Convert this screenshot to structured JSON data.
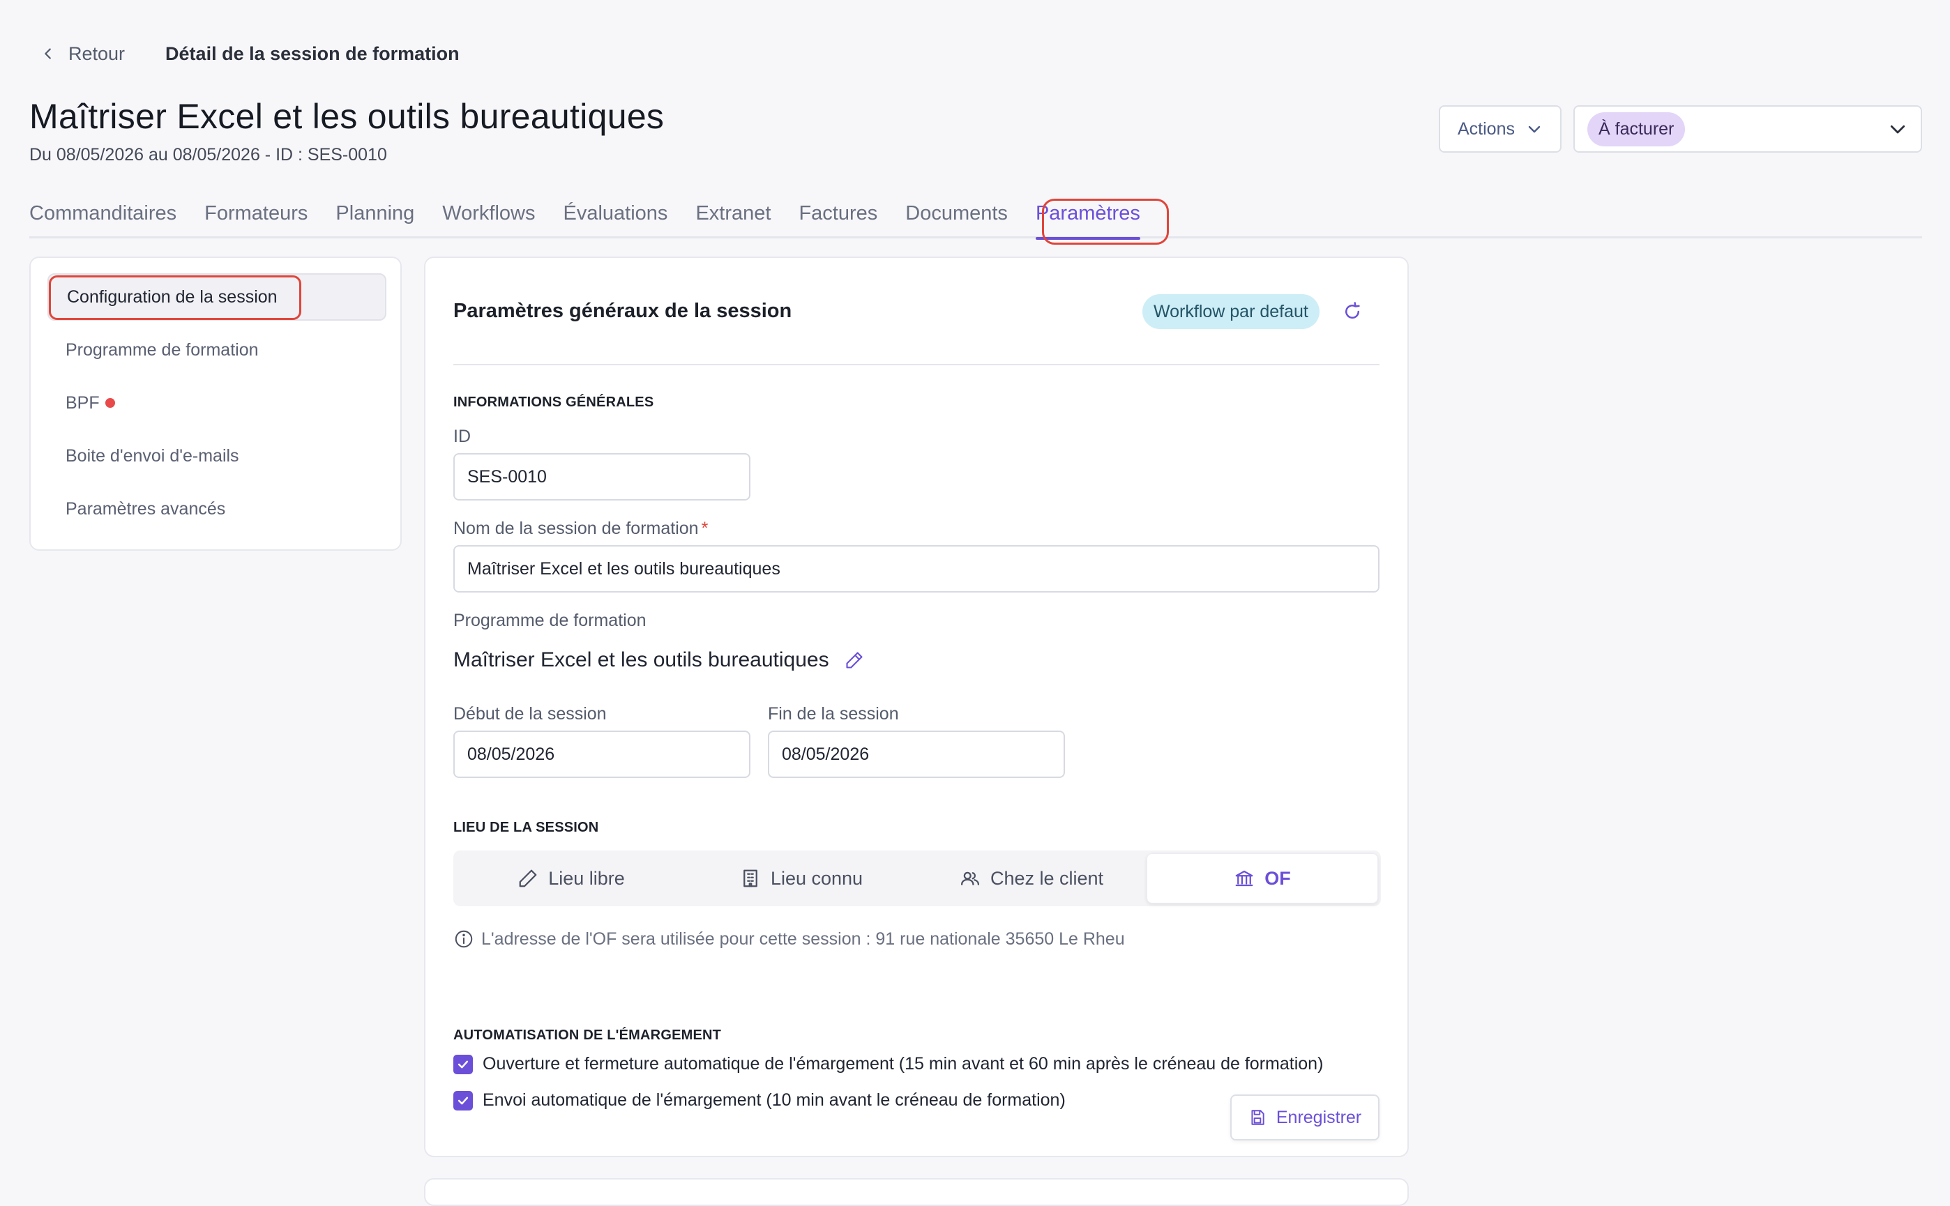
{
  "header": {
    "back_label": "Retour",
    "breadcrumb_title": "Détail de la session de formation",
    "title": "Maîtriser Excel et les outils bureautiques",
    "subtitle": "Du 08/05/2026 au 08/05/2026 - ID : SES-0010",
    "actions_label": "Actions",
    "status_value": "À facturer",
    "status_color": "#e3d5f8"
  },
  "tabs": [
    {
      "label": "Commanditaires",
      "active": false
    },
    {
      "label": "Formateurs",
      "active": false
    },
    {
      "label": "Planning",
      "active": false
    },
    {
      "label": "Workflows",
      "active": false
    },
    {
      "label": "Évaluations",
      "active": false
    },
    {
      "label": "Extranet",
      "active": false
    },
    {
      "label": "Factures",
      "active": false
    },
    {
      "label": "Documents",
      "active": false
    },
    {
      "label": "Paramètres",
      "active": true
    }
  ],
  "sidebar": {
    "items": [
      {
        "label": "Configuration de la session",
        "active": true
      },
      {
        "label": "Programme de formation",
        "active": false
      },
      {
        "label": "BPF",
        "active": false,
        "alert": true
      },
      {
        "label": "Boite d'envoi d'e-mails",
        "active": false
      },
      {
        "label": "Paramètres avancés",
        "active": false
      }
    ]
  },
  "card": {
    "title": "Paramètres généraux de la session",
    "workflow_badge": "Workflow par defaut",
    "sections": {
      "general": "INFORMATIONS GÉNÉRALES",
      "lieu": "LIEU DE LA SESSION",
      "emargement": "AUTOMATISATION DE L'ÉMARGEMENT"
    },
    "fields": {
      "id_label": "ID",
      "id_value": "SES-0010",
      "name_label": "Nom de la session de formation",
      "name_required": "*",
      "name_value": "Maîtriser Excel et les outils bureautiques",
      "programme_label": "Programme de formation",
      "programme_value": "Maîtriser Excel et les outils bureautiques",
      "start_label": "Début de la session",
      "start_value": "08/05/2026",
      "end_label": "Fin de la session",
      "end_value": "08/05/2026"
    },
    "lieu_options": [
      {
        "label": "Lieu libre",
        "icon": "pencil-icon",
        "active": false
      },
      {
        "label": "Lieu connu",
        "icon": "building-icon",
        "active": false
      },
      {
        "label": "Chez le client",
        "icon": "users-icon",
        "active": false
      },
      {
        "label": "OF",
        "icon": "bank-icon",
        "active": true
      }
    ],
    "lieu_info": "L'adresse de l'OF sera utilisée pour cette session : 91 rue nationale 35650 Le Rheu",
    "checks": [
      {
        "label": "Ouverture et fermeture automatique de l'émargement (15 min avant et 60 min après le créneau de formation)",
        "checked": true
      },
      {
        "label": "Envoi automatique de l'émargement (10 min avant le créneau de formation)",
        "checked": true
      }
    ],
    "save_label": "Enregistrer"
  },
  "colors": {
    "accent": "#6b4fd8",
    "highlight_outline": "#e0453a",
    "workflow_badge_bg": "#cdeef6"
  }
}
